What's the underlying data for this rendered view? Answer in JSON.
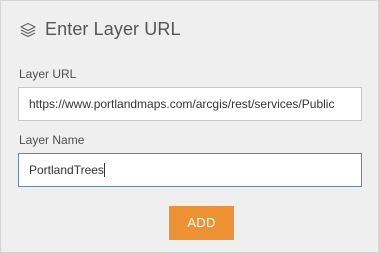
{
  "header": {
    "icon": "layers-icon",
    "title": "Enter Layer URL"
  },
  "layer_url": {
    "label": "Layer URL",
    "value": "https://www.portlandmaps.com/arcgis/rest/services/Public"
  },
  "layer_name": {
    "label": "Layer Name",
    "value": "PortlandTrees"
  },
  "actions": {
    "add_label": "ADD"
  },
  "colors": {
    "panel_background": "#efefef",
    "accent_button": "#ee9133",
    "focused_border": "#6f86a6"
  }
}
